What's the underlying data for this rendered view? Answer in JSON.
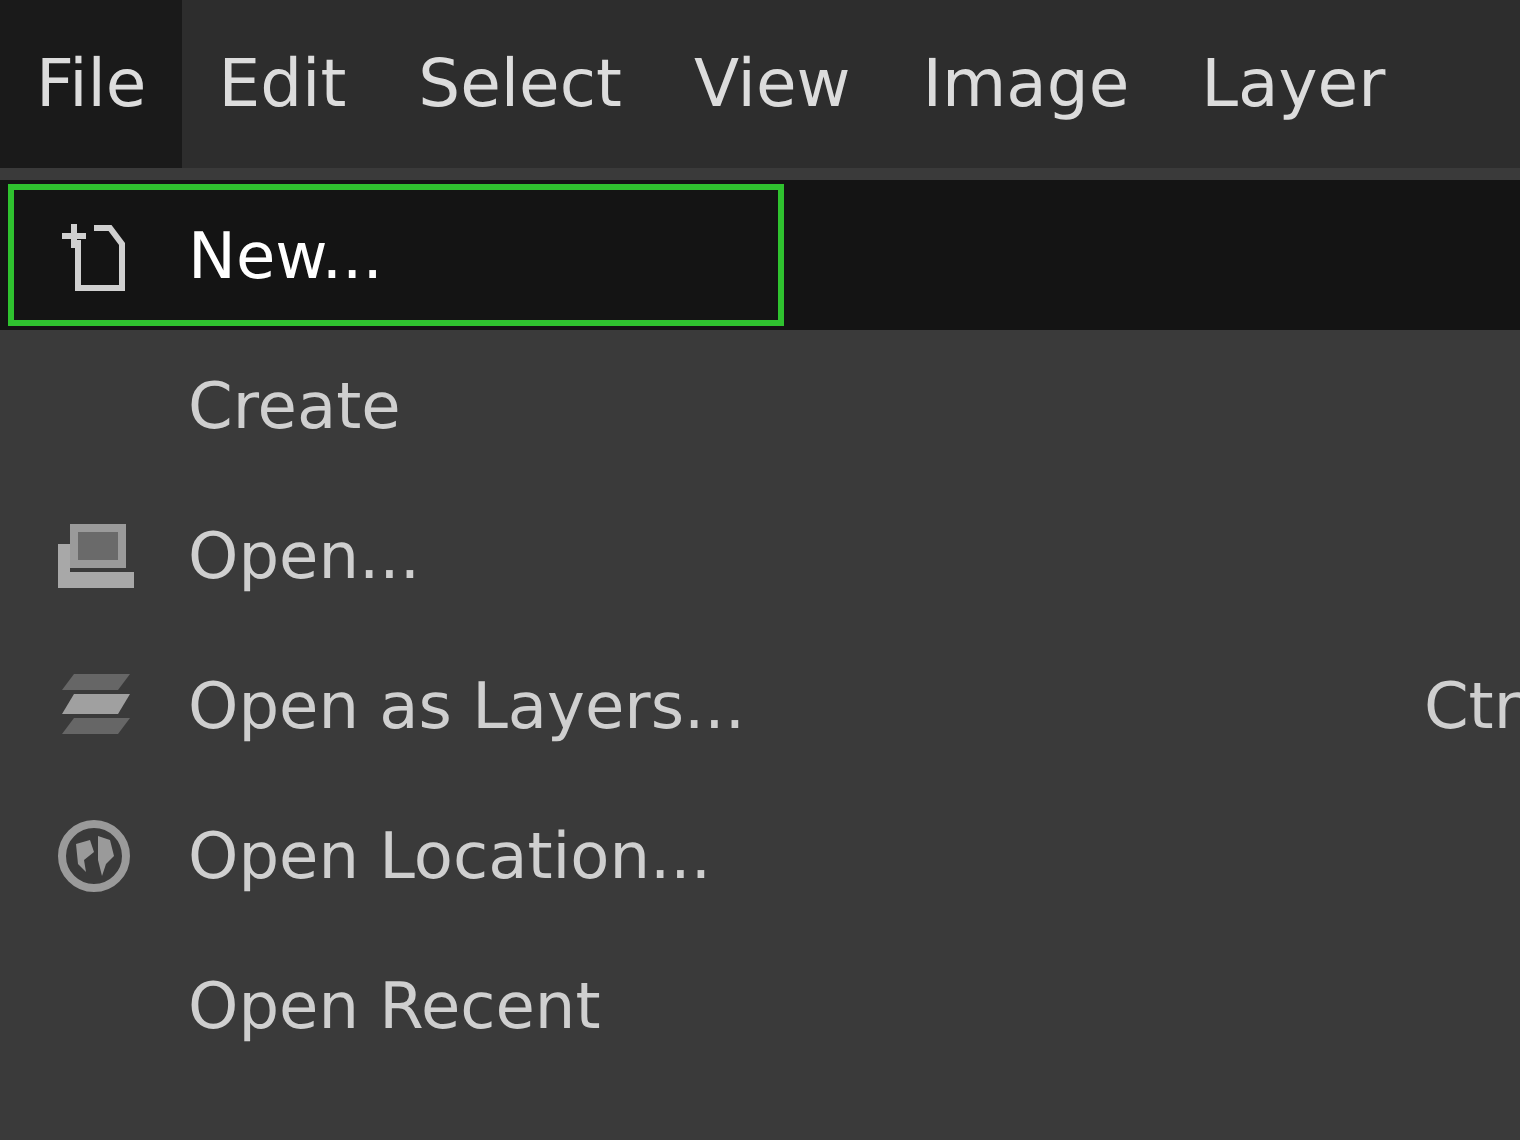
{
  "menubar": [
    {
      "label": "File",
      "selected": true
    },
    {
      "label": "Edit",
      "selected": false
    },
    {
      "label": "Select",
      "selected": false
    },
    {
      "label": "View",
      "selected": false
    },
    {
      "label": "Image",
      "selected": false
    },
    {
      "label": "Layer",
      "selected": false
    }
  ],
  "menu": [
    {
      "label": "New...",
      "kind": "new",
      "selected": true,
      "highlighted": true
    },
    {
      "label": "Create",
      "kind": "none",
      "selected": false,
      "highlighted": false
    },
    {
      "label": "Open...",
      "kind": "open",
      "selected": false,
      "highlighted": false
    },
    {
      "label": "Open as Layers...",
      "kind": "layers",
      "selected": false,
      "highlighted": false,
      "shortcut": "Ctr"
    },
    {
      "label": "Open Location...",
      "kind": "location",
      "selected": false,
      "highlighted": false
    },
    {
      "label": "Open Recent",
      "kind": "none",
      "selected": false,
      "highlighted": false
    }
  ]
}
